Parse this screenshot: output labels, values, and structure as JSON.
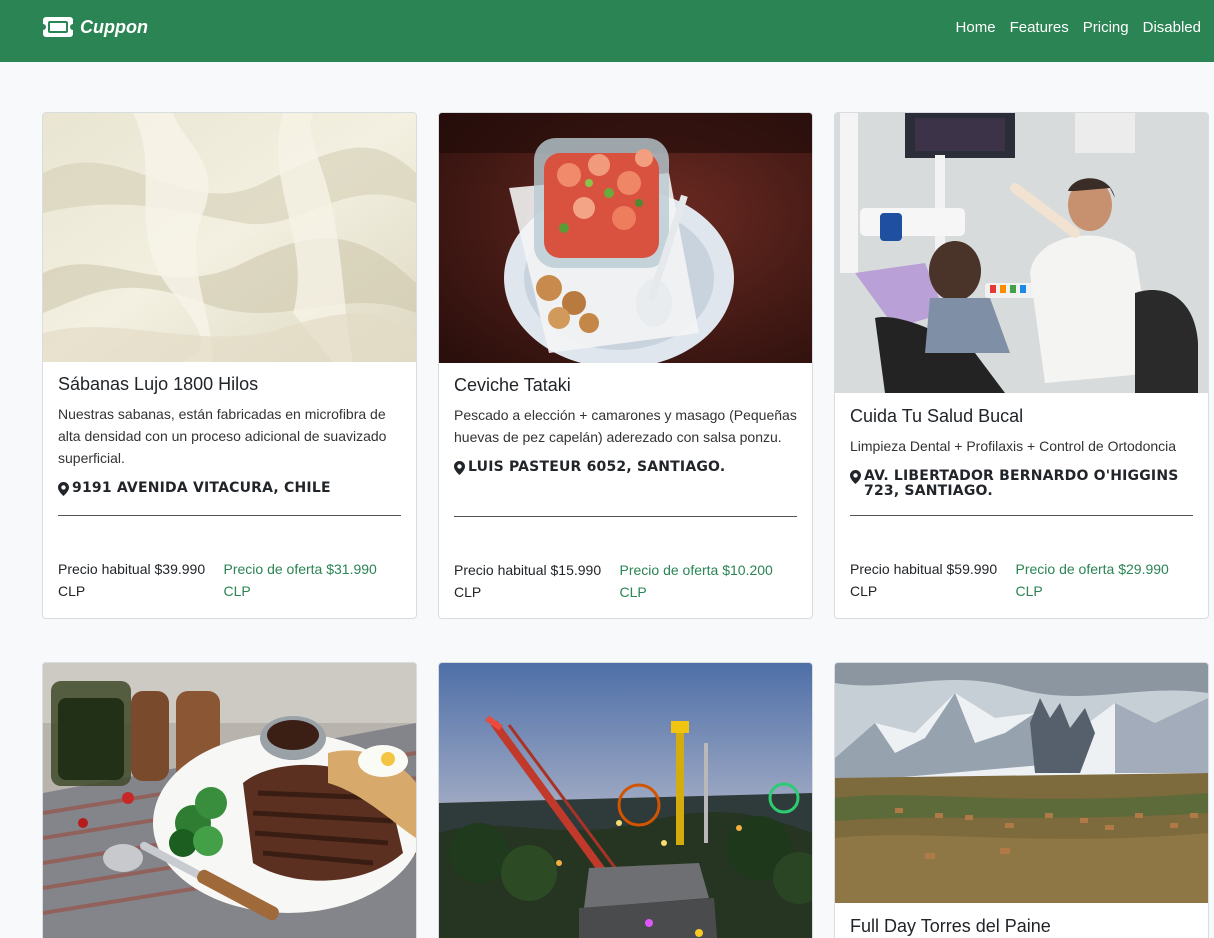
{
  "nav": {
    "brand": "Cuppon",
    "links": [
      "Home",
      "Features",
      "Pricing",
      "Disabled"
    ]
  },
  "cards": [
    {
      "title": "Sábanas Lujo 1800 Hilos",
      "description": "Nuestras sabanas, están fabricadas en microfibra de alta densidad con un proceso adicional de suavizado superficial.",
      "address": "9191 AVENIDA VITACURA, CHILE",
      "price_regular": "Precio habitual $39.990",
      "price_regular_unit": "CLP",
      "price_offer": "Precio de oferta $31.990",
      "price_offer_unit": "CLP"
    },
    {
      "title": "Ceviche Tataki",
      "description": "Pescado a elección + camarones y masago (Pequeñas huevas de pez capelán) aderezado con salsa ponzu.",
      "address": "LUIS PASTEUR 6052, SANTIAGO.",
      "price_regular": "Precio habitual $15.990",
      "price_regular_unit": "CLP",
      "price_offer": "Precio de oferta $10.200",
      "price_offer_unit": "CLP"
    },
    {
      "title": "Cuida Tu Salud Bucal",
      "description": "Limpieza Dental + Profilaxis + Control de Ortodoncia",
      "address": "AV. LIBERTADOR BERNARDO O'HIGGINS 723, SANTIAGO.",
      "price_regular": "Precio habitual $59.990",
      "price_regular_unit": "CLP",
      "price_offer": "Precio de oferta $29.990",
      "price_offer_unit": "CLP"
    },
    {
      "title": "",
      "description": "",
      "address": "",
      "image": "grilled-meat-plate"
    },
    {
      "title": "",
      "description": "",
      "address": "",
      "image": "amusement-park-sunset"
    },
    {
      "title": "Full Day Torres del Paine",
      "description": "",
      "address": "",
      "image": "torres-del-paine-mountains"
    }
  ],
  "icons": {
    "brand": "ticket-icon",
    "address": "map-marker-icon"
  },
  "colors": {
    "navbar": "#2a8453",
    "offer": "#2a8453",
    "background": "#f8f9fa"
  }
}
